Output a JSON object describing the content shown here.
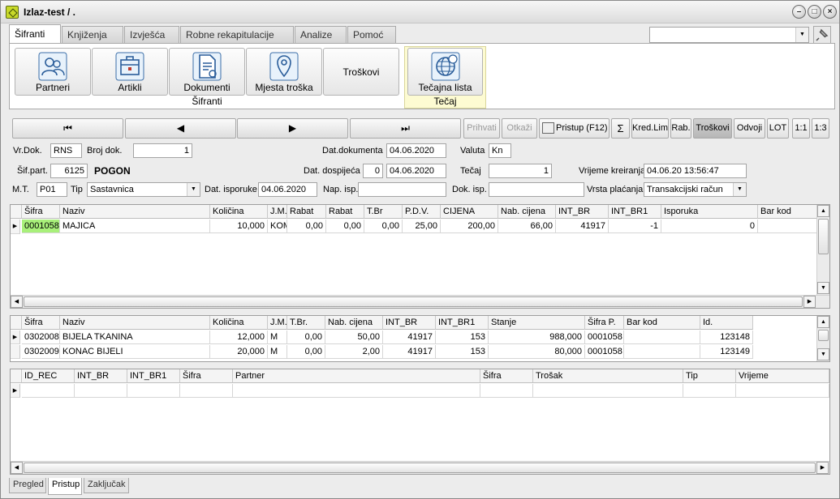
{
  "window": {
    "title": "Izlaz-test / ."
  },
  "menu_tabs": [
    "Šifranti",
    "Knjiženja",
    "Izvješća",
    "Robne rekapitulacije",
    "Analize",
    "Pomoć"
  ],
  "ribbon": {
    "sifranti_buttons": [
      "Partneri",
      "Artikli",
      "Dokumenti",
      "Mjesta troška",
      "Troškovi"
    ],
    "sifranti_group": "Šifranti",
    "tecaj_button": "Tečajna lista",
    "tecaj_group": "Tečaj"
  },
  "toolbar": {
    "prihvati": "Prihvati",
    "otkazi": "Otkaži",
    "pristup": "Pristup (F12)",
    "sum": "Σ",
    "kred_lim": "Kred.Lim",
    "rab": "Rab.",
    "troskovi": "Troškovi",
    "odvoji": "Odvoji",
    "lot": "LOT",
    "ratio1": "1:1",
    "ratio3": "1:3"
  },
  "form": {
    "vr_dok_label": "Vr.Dok.",
    "vr_dok": "RNS",
    "broj_dok_label": "Broj dok.",
    "broj_dok": "1",
    "dat_dokumenta_label": "Dat.dokumenta",
    "dat_dokumenta": "04.06.2020",
    "valuta_label": "Valuta",
    "valuta": "Kn",
    "sif_part_label": "Šif.part.",
    "sif_part": "6125",
    "partner_name": "POGON",
    "dat_dospijeca_label": "Dat. dospijeća",
    "dospijece_dana": "0",
    "dat_dospijeca": "04.06.2020",
    "tecaj_label": "Tečaj",
    "tecaj": "1",
    "vrijeme_kreiranja_label": "Vrijeme kreiranja",
    "vrijeme_kreiranja": "04.06.20 13:56:47",
    "mt_label": "M.T.",
    "mt": "P01",
    "tip_label": "Tip",
    "tip": "Sastavnica",
    "dat_isporuke_label": "Dat. isporuke",
    "dat_isporuke": "04.06.2020",
    "nap_isp_label": "Nap. isp.",
    "nap_isp": "",
    "dok_isp_label": "Dok. isp.",
    "dok_isp": "",
    "vrsta_placanja_label": "Vrsta plaćanja",
    "vrsta_placanja": "Transakcijski račun"
  },
  "grid1": {
    "headers": [
      "Šifra",
      "Naziv",
      "Količina",
      "J.M.",
      "Rabat",
      "Rabat",
      "T.Br",
      "P.D.V.",
      "CIJENA",
      "Nab. cijena",
      "INT_BR",
      "INT_BR1",
      "Isporuka",
      "Bar kod"
    ],
    "rows": [
      [
        "0001058",
        "MAJICA",
        "10,000",
        "KOM",
        "0,00",
        "0,00",
        "0,00",
        "25,00",
        "200,00",
        "66,00",
        "41917",
        "-1",
        "0",
        ""
      ]
    ]
  },
  "grid2": {
    "headers": [
      "Šifra",
      "Naziv",
      "Količina",
      "J.M.",
      "T.Br.",
      "Nab. cijena",
      "INT_BR",
      "INT_BR1",
      "Stanje",
      "Šifra P.",
      "Bar kod",
      "Id."
    ],
    "rows": [
      [
        "0302008",
        "BIJELA TKANINA",
        "12,000",
        "M",
        "0,00",
        "50,00",
        "41917",
        "153",
        "988,000",
        "0001058",
        "",
        "123148"
      ],
      [
        "0302009",
        "KONAC BIJELI",
        "20,000",
        "M",
        "0,00",
        "2,00",
        "41917",
        "153",
        "80,000",
        "0001058",
        "",
        "123149"
      ]
    ]
  },
  "grid3": {
    "headers": [
      "ID_REC",
      "INT_BR",
      "INT_BR1",
      "Šifra",
      "Partner",
      "Šifra",
      "Trošak",
      "Tip",
      "Vrijeme"
    ]
  },
  "bottom_tabs": [
    "Pregled",
    "Pristup",
    "Zaključak"
  ]
}
